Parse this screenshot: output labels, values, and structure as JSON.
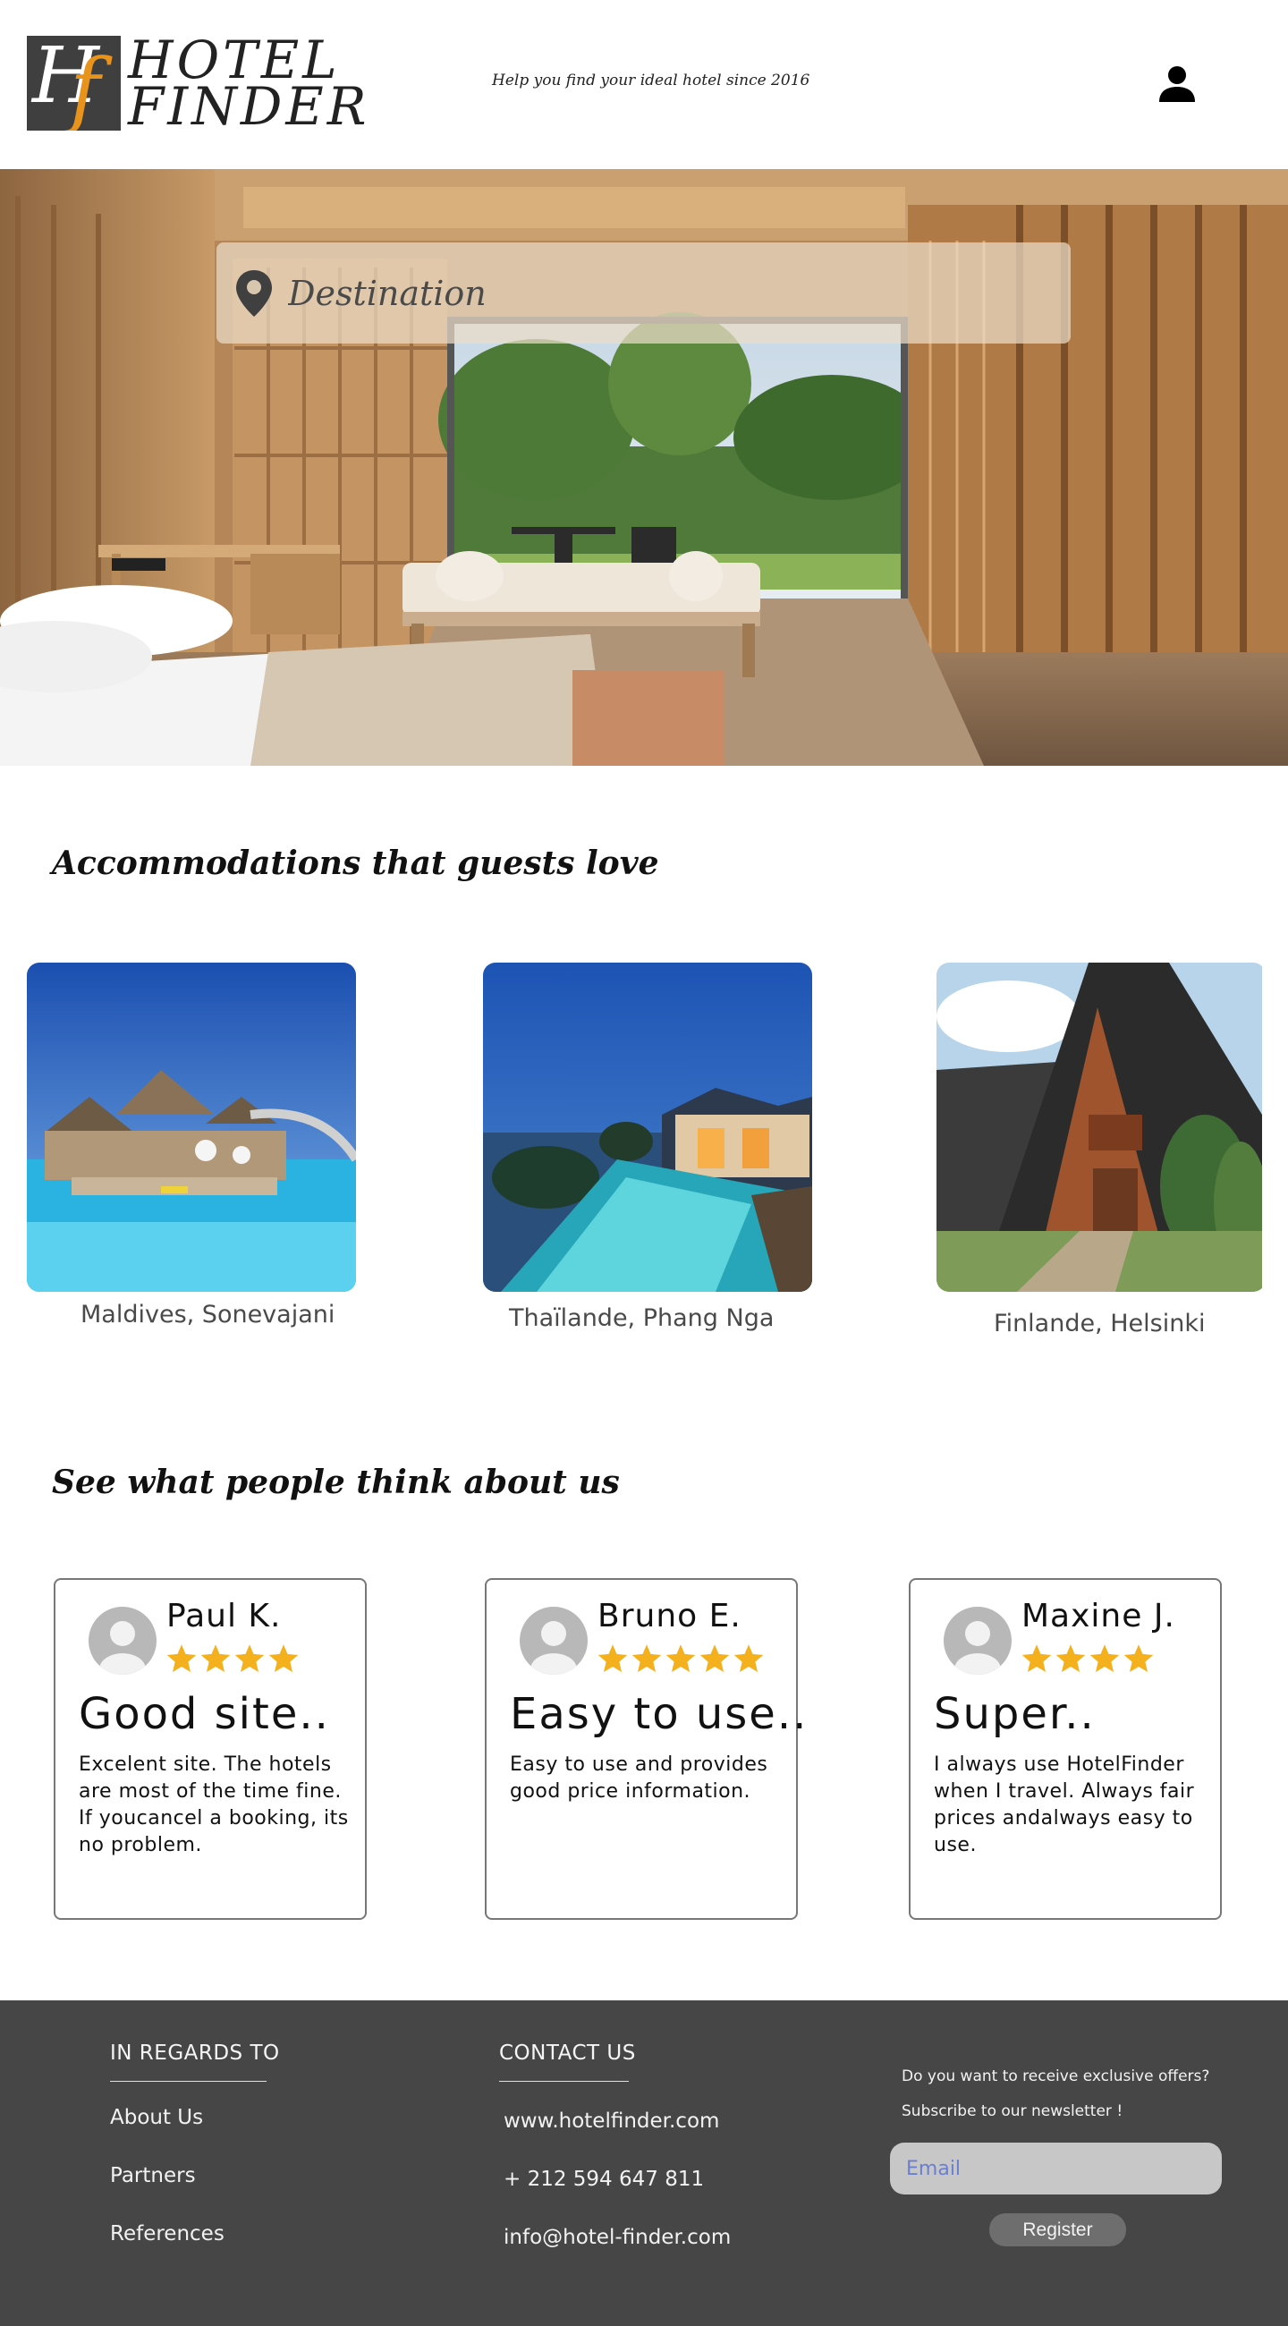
{
  "header": {
    "logo_line1": "HOTEL",
    "logo_line2": "FINDER",
    "logo_mark_h": "H",
    "logo_mark_f": "f",
    "tagline": "Help you find your ideal hotel since 2016",
    "user_icon": "user-icon"
  },
  "hero": {
    "search_placeholder": "Destination",
    "search_icon": "map-pin-icon"
  },
  "accommodations": {
    "title": "Accommodations that guests love",
    "items": [
      {
        "caption": "Maldives, Sonevajani"
      },
      {
        "caption": "Thaïlande, Phang Nga"
      },
      {
        "caption": "Finlande, Helsinki"
      }
    ]
  },
  "reviews": {
    "title": "See what people think about us",
    "items": [
      {
        "name": "Paul K.",
        "rating": 4,
        "headline": "Good site..",
        "body": "Excelent site. The hotels are most of the time fine. If youcancel a booking, its no problem."
      },
      {
        "name": "Bruno E.",
        "rating": 5,
        "headline": "Easy to use..",
        "body": "Easy to use and provides good price information."
      },
      {
        "name": "Maxine J.",
        "rating": 4,
        "headline": "Super..",
        "body": "I always use HotelFinder when I travel. Always fair prices andalways easy to use."
      }
    ]
  },
  "footer": {
    "regards": {
      "heading": "IN REGARDS TO",
      "links": [
        "About Us",
        "Partners",
        "References"
      ]
    },
    "contact": {
      "heading": "CONTACT US",
      "website": "www.hotelfinder.com",
      "phone": "+ 212 594 647 811",
      "email": "info@hotel-finder.com"
    },
    "newsletter": {
      "line1": "Do you want to receive exclusive offers?",
      "line2": "Subscribe to our newsletter !",
      "email_placeholder": "Email",
      "register_label": "Register"
    }
  },
  "colors": {
    "star": "#F5B01E",
    "footer_bg": "#464646",
    "logo_accent": "#E8941C"
  }
}
